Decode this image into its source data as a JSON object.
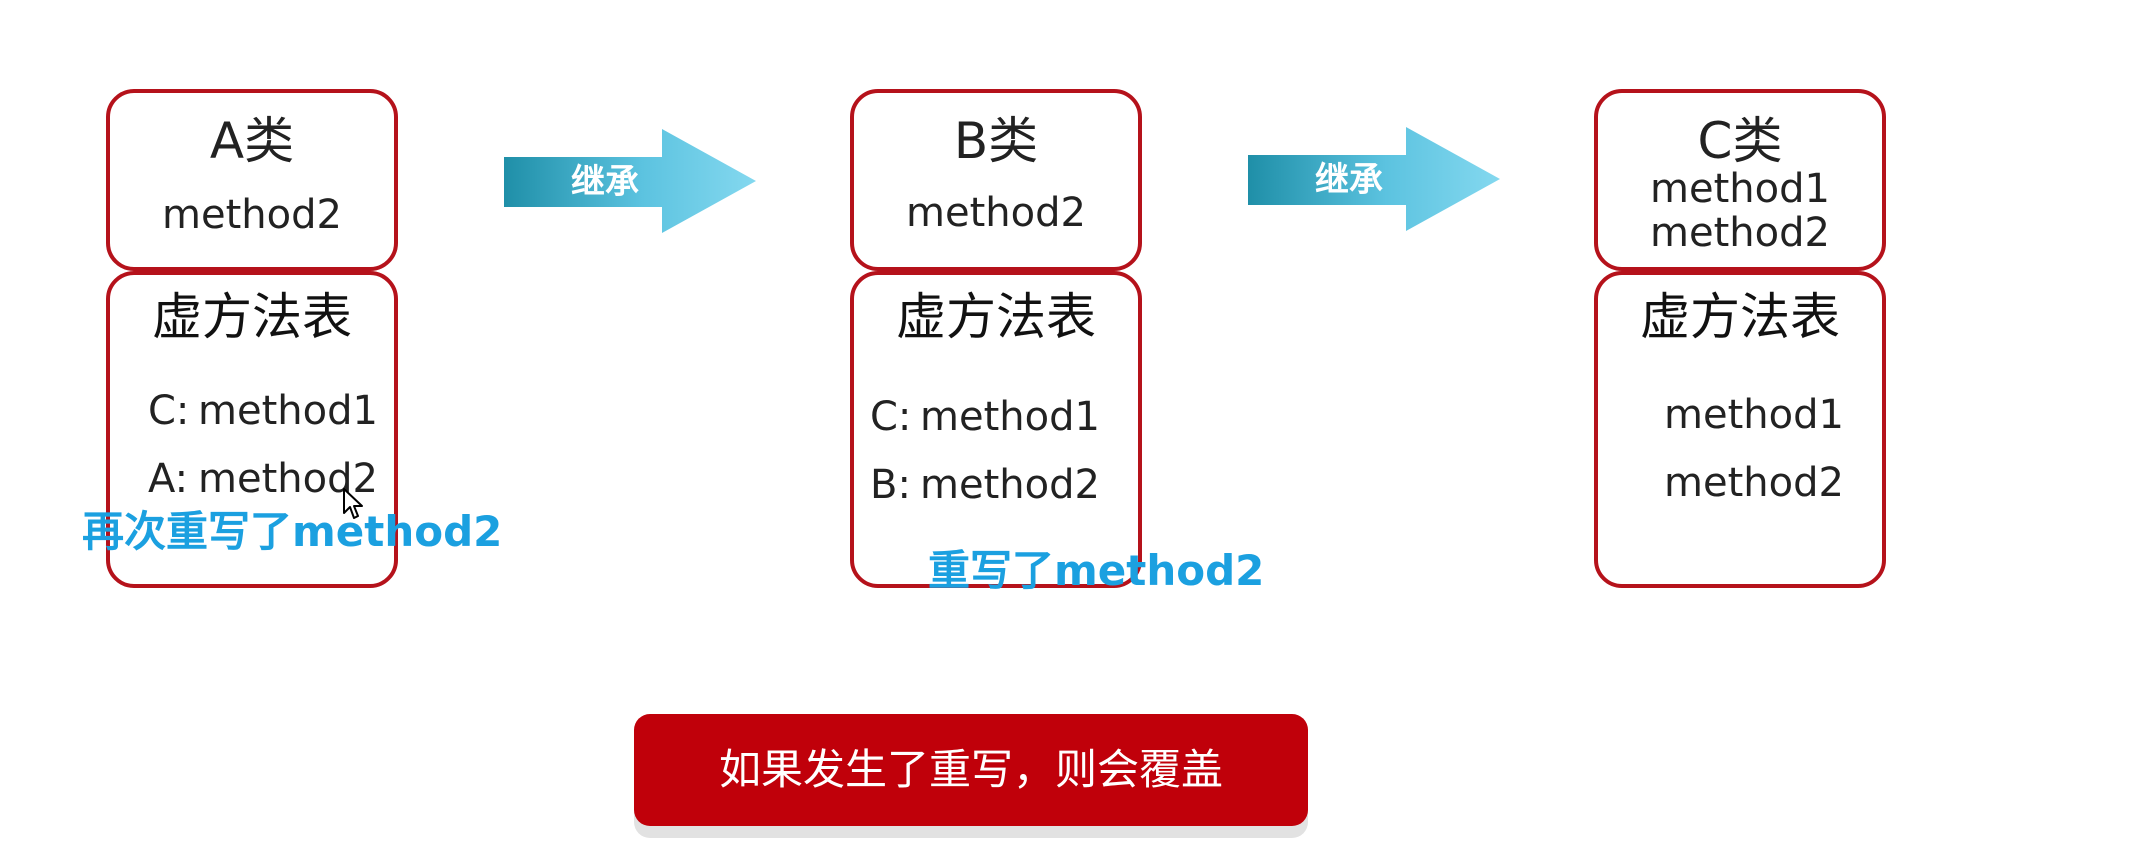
{
  "columns": [
    {
      "class_name": "A类",
      "class_methods": [
        "method2"
      ],
      "vtable_title": "虚方法表",
      "vtable_entries": [
        {
          "owner": "C:",
          "method": "method1"
        },
        {
          "owner": "A:",
          "method": "method2"
        }
      ],
      "annotation": "再次重写了method2"
    },
    {
      "class_name": "B类",
      "class_methods": [
        "method2"
      ],
      "vtable_title": "虚方法表",
      "vtable_entries": [
        {
          "owner": "C:",
          "method": "method1"
        },
        {
          "owner": "B:",
          "method": "method2"
        }
      ],
      "annotation": "重写了method2"
    },
    {
      "class_name": "C类",
      "class_methods": [
        "method1",
        "method2"
      ],
      "vtable_title": "虚方法表",
      "vtable_entries": [
        {
          "owner": "",
          "method": "method1"
        },
        {
          "owner": "",
          "method": "method2"
        }
      ]
    }
  ],
  "arrows": [
    {
      "label": "继承"
    },
    {
      "label": "继承"
    }
  ],
  "note": "如果发生了重写，则会覆盖",
  "colors": {
    "box_border": "#b5121b",
    "annotation": "#1ba0e0",
    "note_background": "#c0000a",
    "arrow_dark": "#1f8fa8",
    "arrow_light": "#78d2ec"
  }
}
